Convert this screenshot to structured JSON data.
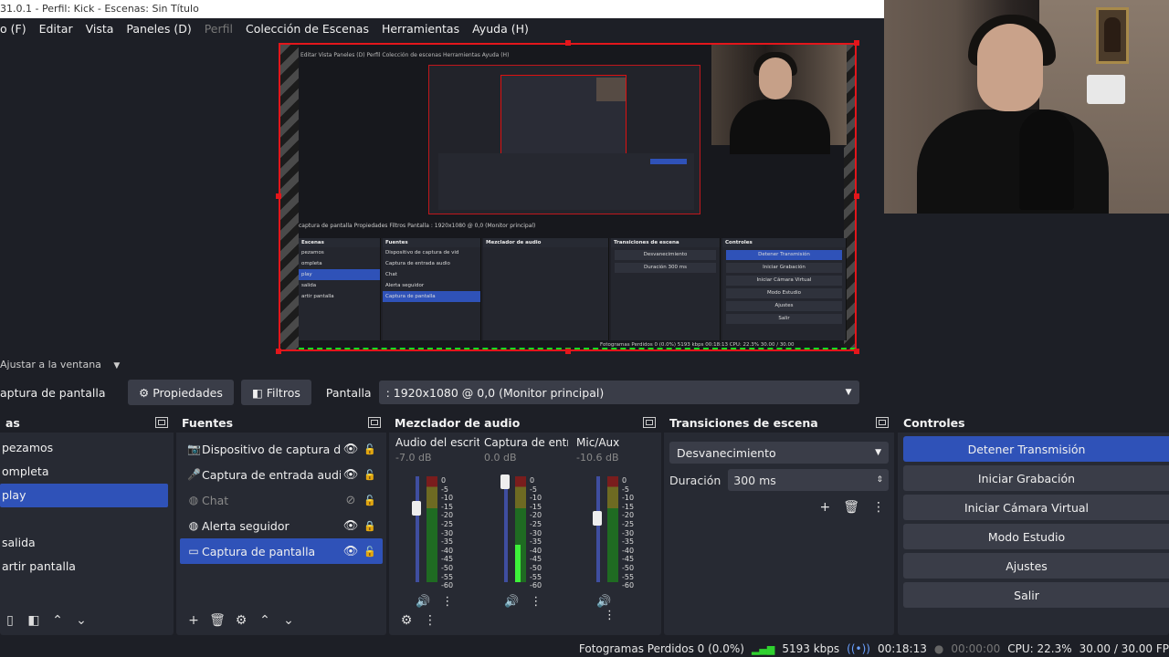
{
  "window": {
    "title": "31.0.1 - Perfil: Kick - Escenas: Sin Título"
  },
  "menu": [
    "o (F)",
    "Editar",
    "Vista",
    "Paneles (D)",
    "Perfil",
    "Colección de Escenas",
    "Herramientas",
    "Ayuda (H)"
  ],
  "scale": {
    "label": "Ajustar a la ventana"
  },
  "toolbar": {
    "source_name": "aptura de pantalla",
    "properties": "Propiedades",
    "filters": "Filtros",
    "display_label": "Pantalla",
    "display_value": ": 1920x1080 @ 0,0 (Monitor principal)"
  },
  "scenes": {
    "title": "as",
    "items": [
      "pezamos",
      "ompleta",
      "play",
      "",
      "salida",
      "artir pantalla"
    ],
    "selected": 2
  },
  "sources": {
    "title": "Fuentes",
    "items": [
      {
        "name": "Dispositivo de captura de vid",
        "icon": "camera-icon",
        "visible": true,
        "locked": false,
        "dim": false
      },
      {
        "name": "Captura de entrada audio",
        "icon": "microphone-icon",
        "visible": true,
        "locked": false,
        "dim": false
      },
      {
        "name": "Chat",
        "icon": "globe-icon",
        "visible": false,
        "locked": false,
        "dim": true
      },
      {
        "name": "Alerta seguidor",
        "icon": "globe-icon",
        "visible": true,
        "locked": true,
        "dim": false
      },
      {
        "name": "Captura de pantalla",
        "icon": "monitor-icon",
        "visible": true,
        "locked": false,
        "dim": false
      }
    ],
    "selected": 4
  },
  "mixer": {
    "title": "Mezclador de audio",
    "channels": [
      {
        "name": "Audio del escrito",
        "db": "-7.0 dB",
        "fader": 0.7,
        "level": 0.0
      },
      {
        "name": "Captura de entra",
        "db": "0.0 dB",
        "fader": 0.95,
        "level": 0.35
      },
      {
        "name": "Mic/Aux",
        "db": "-10.6 dB",
        "fader": 0.6,
        "level": 0.0
      }
    ],
    "scale": [
      "0",
      "-5",
      "-10",
      "-15",
      "-20",
      "-25",
      "-30",
      "-35",
      "-40",
      "-45",
      "-50",
      "-55",
      "-60"
    ]
  },
  "transitions": {
    "title": "Transiciones de escena",
    "selected": "Desvanecimiento",
    "duration_label": "Duración",
    "duration_value": "300 ms"
  },
  "controls": {
    "title": "Controles",
    "buttons": [
      "Detener Transmisión",
      "Iniciar Grabación",
      "Iniciar Cámara Virtual",
      "Modo Estudio",
      "Ajustes",
      "Salir"
    ]
  },
  "status": {
    "dropped": "Fotogramas Perdidos 0 (0.0%)",
    "bitrate": "5193 kbps",
    "stream_time": "00:18:13",
    "rec_time": "00:00:00",
    "cpu": "CPU: 22.3%",
    "fps": "30.00 / 30.00 FP"
  },
  "inner_preview": {
    "menu": "Editar   Vista   Paneles (D)   Perfil   Colección de escenas   Herramientas   Ayuda (H)",
    "toolbar": "captura de pantalla        Propiedades   Filtros   Pantalla  : 1920x1080 @ 0,0 (Monitor principal)",
    "status": "Fotogramas Perdidos 0 (0.0%)   5193 kbps   00:18:13   CPU: 22.3%   30.00 / 30.00"
  },
  "colors": {
    "accent": "#2f52b8",
    "panel": "#272a33",
    "bg": "#1d1f26",
    "canvas_border": "#e3161b"
  }
}
